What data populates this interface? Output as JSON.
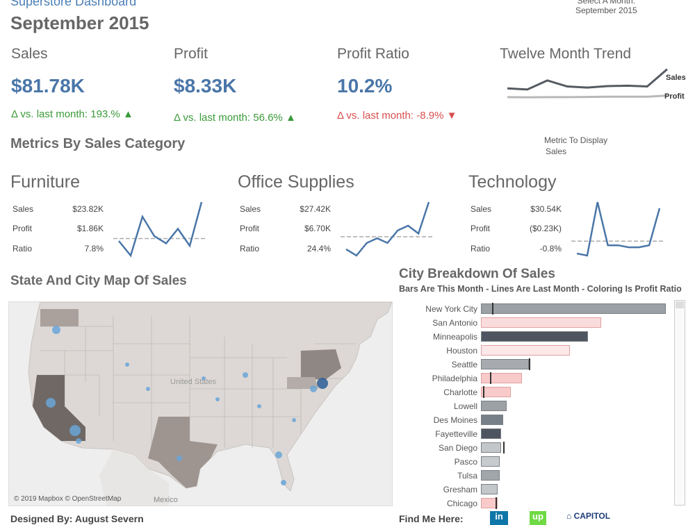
{
  "header": {
    "app_title": "Superstore Dashboard",
    "page_title": "September 2015",
    "month_selector_label": "Select A Month:",
    "month_selector_value": "September 2015"
  },
  "kpis": [
    {
      "label": "Sales",
      "value": "$81.78K",
      "delta": "Δ vs. last month: 193.%",
      "arrow": "▲",
      "trend": "up"
    },
    {
      "label": "Profit",
      "value": "$8.33K",
      "delta": "Δ vs. last month: 56.6%",
      "arrow": "▲",
      "trend": "up"
    },
    {
      "label": "Profit Ratio",
      "value": "10.2%",
      "delta": "Δ vs. last month: -8.9%",
      "arrow": "▼",
      "trend": "down"
    }
  ],
  "trend": {
    "title": "Twelve Month Trend",
    "sales_label": "Sales",
    "profit_label": "Profit",
    "sales_values": [
      31,
      28,
      52,
      36,
      33,
      37,
      38,
      36,
      82
    ],
    "profit_values": [
      4,
      3.5,
      4,
      4,
      4.5,
      5,
      5,
      5,
      8
    ]
  },
  "metric_display": {
    "label": "Metric To Display",
    "value": "Sales"
  },
  "category_section": {
    "title": "Metrics By Sales Category"
  },
  "categories": [
    {
      "name": "Furniture",
      "rows": [
        {
          "label": "Sales",
          "value": "$23.82K"
        },
        {
          "label": "Profit",
          "value": "$1.86K"
        },
        {
          "label": "Ratio",
          "value": "7.8%"
        }
      ],
      "spark": [
        12,
        6,
        22,
        14,
        11,
        17,
        10,
        28
      ],
      "avg": 13
    },
    {
      "name": "Office Supplies",
      "rows": [
        {
          "label": "Sales",
          "value": "$27.42K"
        },
        {
          "label": "Profit",
          "value": "$6.70K"
        },
        {
          "label": "Ratio",
          "value": "24.4%"
        }
      ],
      "spark": [
        6,
        2,
        10,
        13,
        10,
        18,
        21,
        16,
        36
      ],
      "avg": 14
    },
    {
      "name": "Technology",
      "rows": [
        {
          "label": "Sales",
          "value": "$30.54K"
        },
        {
          "label": "Profit",
          "value": "($0.23K)"
        },
        {
          "label": "Ratio",
          "value": "-0.8%"
        }
      ],
      "spark": [
        8,
        7,
        33,
        12,
        12,
        11,
        11,
        12,
        30
      ],
      "avg": 14
    }
  ],
  "map": {
    "title": "State And City Map Of Sales",
    "credits": "© 2019 Mapbox © OpenStreetMap",
    "country_label": "United States",
    "mexico_label": "Mexico"
  },
  "city_breakdown": {
    "title": "City Breakdown Of Sales",
    "subtitle": "Bars Are This Month - Lines Are Last Month - Coloring Is Profit Ratio",
    "cities": [
      {
        "name": "New York City",
        "value": 100,
        "last": 6,
        "color": "#9aa0a4"
      },
      {
        "name": "San Antonio",
        "value": 65,
        "last": null,
        "color": "#fbdcdc"
      },
      {
        "name": "Minneapolis",
        "value": 58,
        "last": null,
        "color": "#4e5560"
      },
      {
        "name": "Houston",
        "value": 48,
        "last": null,
        "color": "#fde8e8"
      },
      {
        "name": "Seattle",
        "value": 26,
        "last": 26,
        "color": "#a7abaf"
      },
      {
        "name": "Philadelphia",
        "value": 22,
        "last": 5,
        "color": "#f9caca"
      },
      {
        "name": "Charlotte",
        "value": 16,
        "last": 1,
        "color": "#f9caca"
      },
      {
        "name": "Lowell",
        "value": 14,
        "last": null,
        "color": "#9ca1a5"
      },
      {
        "name": "Des Moines",
        "value": 12,
        "last": null,
        "color": "#777f88"
      },
      {
        "name": "Fayetteville",
        "value": 11,
        "last": null,
        "color": "#4e5560"
      },
      {
        "name": "San Diego",
        "value": 11,
        "last": 12,
        "color": "#c4c7ca"
      },
      {
        "name": "Pasco",
        "value": 10,
        "last": null,
        "color": "#c8cbce"
      },
      {
        "name": "Tulsa",
        "value": 10,
        "last": null,
        "color": "#a1a6aa"
      },
      {
        "name": "Gresham",
        "value": 9,
        "last": null,
        "color": "#c4c7ca"
      },
      {
        "name": "Chicago",
        "value": 9,
        "last": 8,
        "color": "#f9caca"
      }
    ]
  },
  "footer": {
    "designed_by": "Designed By: August Severn",
    "find_me": "Find Me Here:",
    "linkedin_text": "in",
    "upwork_text": "up",
    "capitol_text": "CAPITOL"
  },
  "colors": {
    "accent": "#4a76a8",
    "positive": "#3a9a3a",
    "negative": "#d94f4f",
    "spark": "#4a76a8"
  }
}
